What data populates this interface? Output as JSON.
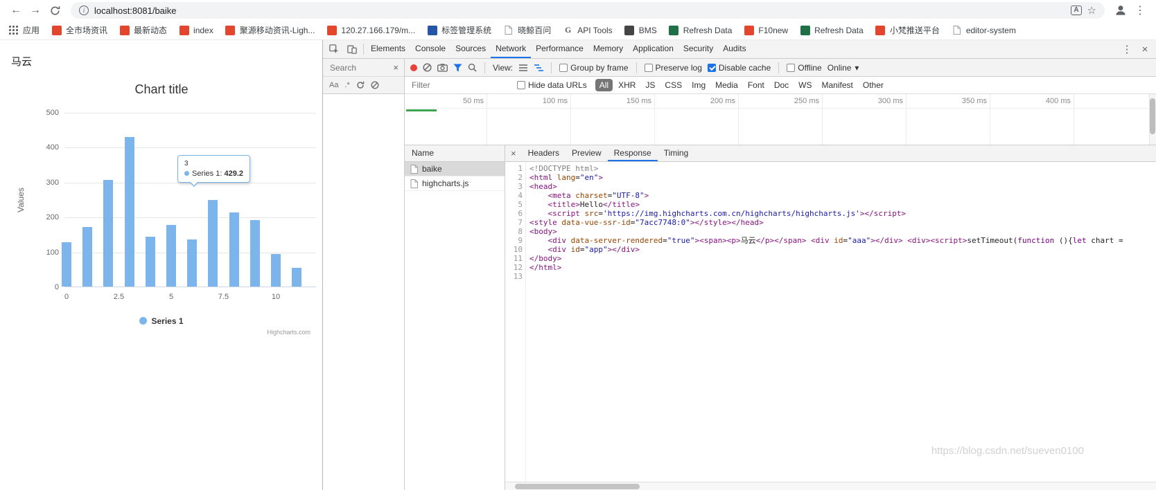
{
  "icons": {
    "back": "←",
    "forward": "→",
    "star": "☆",
    "menu_kebab": "⋮",
    "close": "×",
    "caret_down": "▾",
    "match_case": "Aa",
    "regex": ".*",
    "info": "i",
    "translate": "A"
  },
  "colors": {
    "accent": "#1a73e8",
    "series": "#7cb5ec",
    "record": "#e8403a",
    "load_bar": "#3fa450",
    "selected_filter_bg": "#757575"
  },
  "browser": {
    "url": "localhost:8081/baike",
    "bookmarks": [
      {
        "label": "应用",
        "icon": "apps"
      },
      {
        "label": "全市场资讯",
        "icon": "red"
      },
      {
        "label": "最新动态",
        "icon": "red"
      },
      {
        "label": "index",
        "icon": "red"
      },
      {
        "label": "聚源移动资讯-Ligh...",
        "icon": "red"
      },
      {
        "label": "120.27.166.179/m...",
        "icon": "red"
      },
      {
        "label": "标签管理系统",
        "icon": "blue"
      },
      {
        "label": "晓鲸百问",
        "icon": "page"
      },
      {
        "label": "API Tools",
        "icon": "g"
      },
      {
        "label": "BMS",
        "icon": "dark"
      },
      {
        "label": "Refresh Data",
        "icon": "excel"
      },
      {
        "label": "F10new",
        "icon": "red"
      },
      {
        "label": "Refresh Data",
        "icon": "excel"
      },
      {
        "label": "小梵推送平台",
        "icon": "red"
      },
      {
        "label": "editor-system",
        "icon": "page"
      }
    ]
  },
  "page": {
    "heading": "马云"
  },
  "chart_data": {
    "type": "bar",
    "title": "Chart title",
    "xlabel": "",
    "ylabel": "Values",
    "x": [
      0,
      1,
      2,
      3,
      4,
      5,
      6,
      7,
      8,
      9,
      10,
      11
    ],
    "series": [
      {
        "name": "Series 1",
        "values": [
          128,
          170,
          305,
          429.2,
          143,
          176,
          134,
          249,
          212,
          190,
          94,
          53
        ]
      }
    ],
    "xticks": [
      0,
      2.5,
      5,
      7.5,
      10
    ],
    "yticks": [
      0,
      100,
      200,
      300,
      400,
      500
    ],
    "ylim": [
      0,
      500
    ],
    "grid": true,
    "legend": [
      "Series 1"
    ],
    "legend_position": "bottom",
    "tooltip": {
      "header": "3",
      "label": "Series 1: ",
      "value": "429.2"
    },
    "credits": "Highcharts.com"
  },
  "devtools": {
    "tabs": [
      "Elements",
      "Console",
      "Sources",
      "Network",
      "Performance",
      "Memory",
      "Application",
      "Security",
      "Audits"
    ],
    "active_tab": "Network",
    "search_pane": {
      "placeholder": "Search"
    },
    "network": {
      "toolbar": {
        "view_label": "View:",
        "checkboxes": [
          {
            "label": "Group by frame",
            "checked": false
          },
          {
            "label": "Preserve log",
            "checked": false
          },
          {
            "label": "Disable cache",
            "checked": true
          },
          {
            "label": "Offline",
            "checked": false
          }
        ],
        "throttling": "Online"
      },
      "filter": {
        "placeholder": "Filter",
        "hide_data_urls": {
          "label": "Hide data URLs",
          "checked": false
        },
        "types": [
          "All",
          "XHR",
          "JS",
          "CSS",
          "Img",
          "Media",
          "Font",
          "Doc",
          "WS",
          "Manifest",
          "Other"
        ],
        "selected_type": "All"
      },
      "timeline_labels": [
        "50 ms",
        "100 ms",
        "150 ms",
        "200 ms",
        "250 ms",
        "300 ms",
        "350 ms",
        "400 ms"
      ],
      "requests_header": "Name",
      "requests": [
        {
          "name": "baike",
          "selected": true
        },
        {
          "name": "highcharts.js",
          "selected": false
        }
      ],
      "detail_tabs": [
        "Headers",
        "Preview",
        "Response",
        "Timing"
      ],
      "active_detail_tab": "Response",
      "response_lines": [
        [
          [
            "g",
            "<!DOCTYPE html>"
          ]
        ],
        [
          [
            "t",
            "<html"
          ],
          [
            "x",
            " "
          ],
          [
            "a",
            "lang"
          ],
          [
            "x",
            "="
          ],
          [
            "s",
            "\"en\""
          ],
          [
            "t",
            ">"
          ]
        ],
        [
          [
            "t",
            "<head>"
          ]
        ],
        [
          [
            "x",
            "    "
          ],
          [
            "t",
            "<meta"
          ],
          [
            "x",
            " "
          ],
          [
            "a",
            "charset"
          ],
          [
            "x",
            "="
          ],
          [
            "s",
            "\"UTF-8\""
          ],
          [
            "t",
            ">"
          ]
        ],
        [
          [
            "x",
            "    "
          ],
          [
            "t",
            "<title>"
          ],
          [
            "x",
            "Hello"
          ],
          [
            "t",
            "</title>"
          ]
        ],
        [
          [
            "x",
            "    "
          ],
          [
            "t",
            "<script"
          ],
          [
            "x",
            " "
          ],
          [
            "a",
            "src"
          ],
          [
            "x",
            "="
          ],
          [
            "s",
            "'https://img.highcharts.com.cn/highcharts/highcharts.js'"
          ],
          [
            "t",
            "></script>"
          ]
        ],
        [
          [
            "t",
            "<style"
          ],
          [
            "x",
            " "
          ],
          [
            "a",
            "data-vue-ssr-id"
          ],
          [
            "x",
            "="
          ],
          [
            "s",
            "\"7acc7748:0\""
          ],
          [
            "t",
            "></style></head>"
          ]
        ],
        [
          [
            "t",
            "<body>"
          ]
        ],
        [
          [
            "x",
            "    "
          ],
          [
            "t",
            "<div"
          ],
          [
            "x",
            " "
          ],
          [
            "a",
            "data-server-rendered"
          ],
          [
            "x",
            "="
          ],
          [
            "s",
            "\"true\""
          ],
          [
            "t",
            "><span><p>"
          ],
          [
            "x",
            "马云"
          ],
          [
            "t",
            "</p></span>"
          ],
          [
            "x",
            " "
          ],
          [
            "t",
            "<div"
          ],
          [
            "x",
            " "
          ],
          [
            "a",
            "id"
          ],
          [
            "x",
            "="
          ],
          [
            "s",
            "\"aaa\""
          ],
          [
            "t",
            "></div>"
          ],
          [
            "x",
            " "
          ],
          [
            "t",
            "<div><script>"
          ],
          [
            "x",
            "setTimeout("
          ],
          [
            "k",
            "function"
          ],
          [
            "x",
            " (){"
          ],
          [
            "k",
            "let"
          ],
          [
            "x",
            " chart = "
          ]
        ],
        [
          [
            "x",
            "    "
          ],
          [
            "t",
            "<div"
          ],
          [
            "x",
            " "
          ],
          [
            "a",
            "id"
          ],
          [
            "x",
            "="
          ],
          [
            "s",
            "\"app\""
          ],
          [
            "t",
            "></div>"
          ]
        ],
        [
          [
            "t",
            "</body>"
          ]
        ],
        [
          [
            "t",
            "</html>"
          ]
        ],
        []
      ]
    }
  },
  "watermark": "https://blog.csdn.net/sueven0100"
}
